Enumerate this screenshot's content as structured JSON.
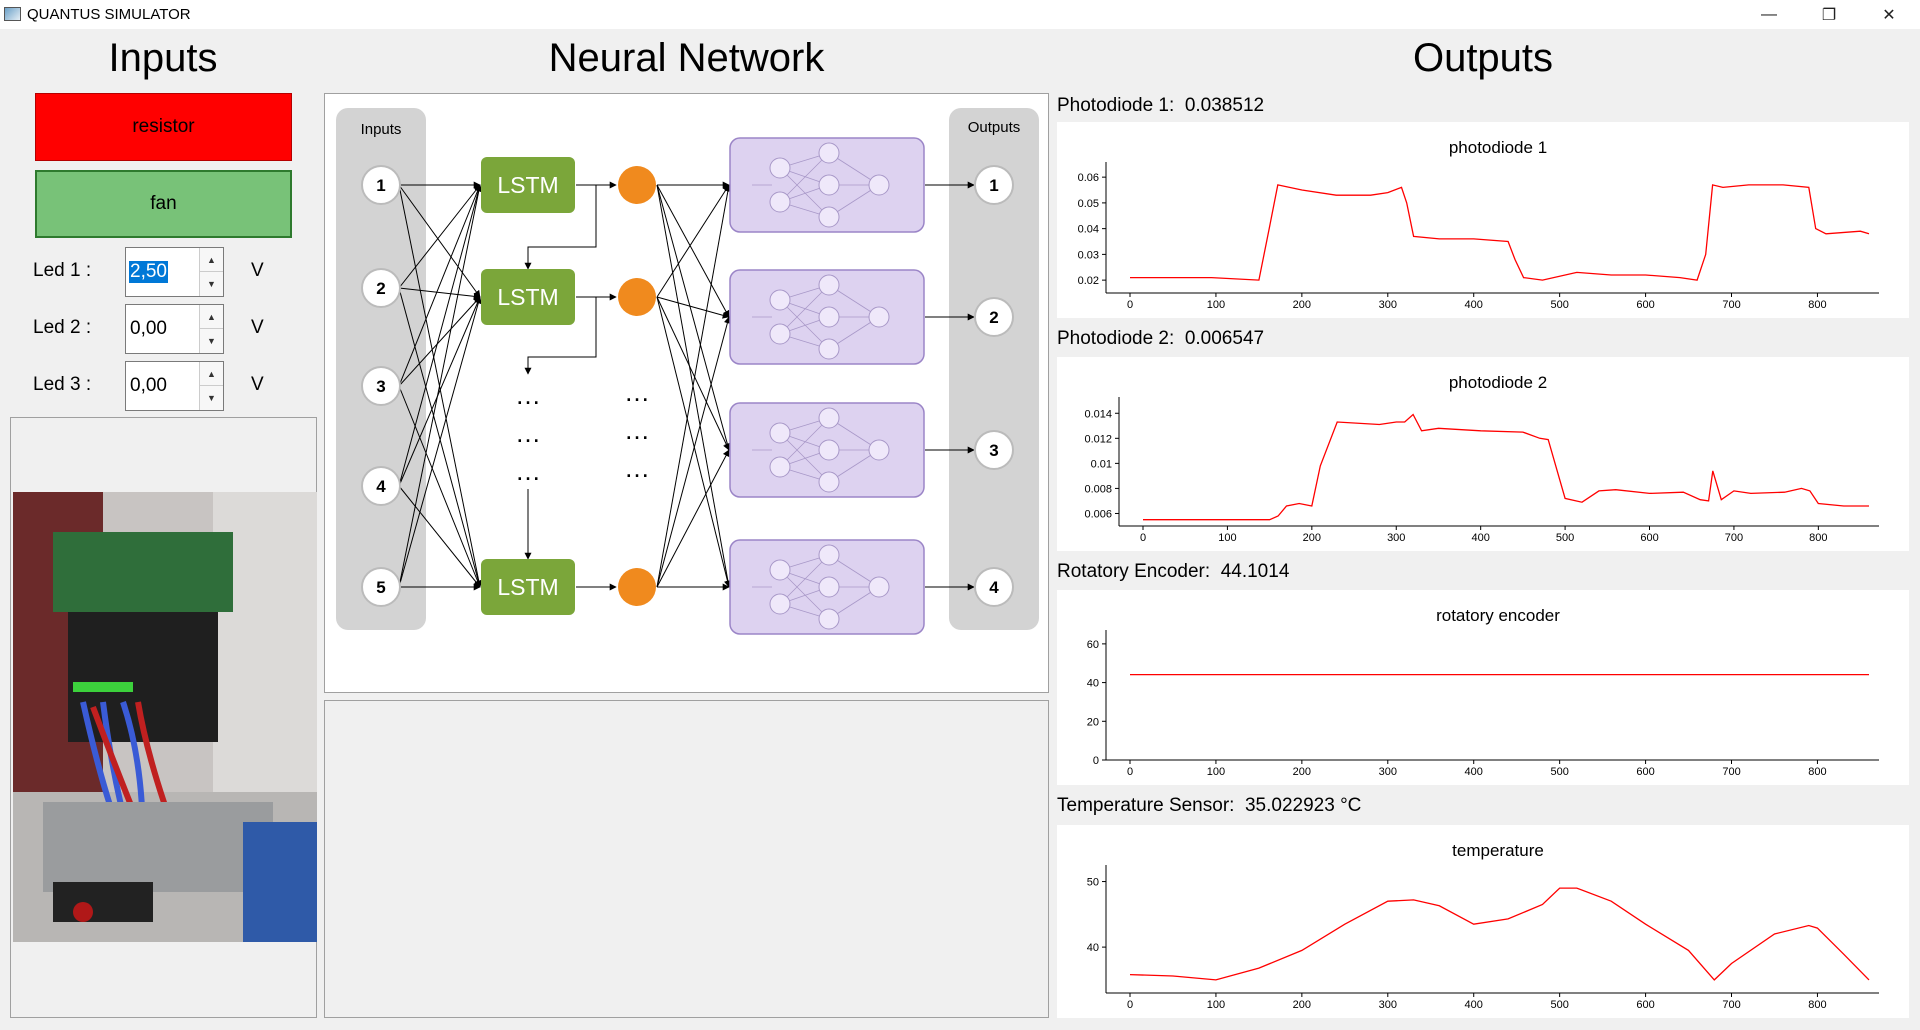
{
  "window": {
    "title": "QUANTUS SIMULATOR",
    "minimize_icon": "minimize-icon",
    "restore_icon": "restore-icon",
    "close_icon": "close-icon"
  },
  "inputs": {
    "title": "Inputs",
    "resistor_label": "resistor",
    "resistor_color": "#ff0000",
    "fan_label": "fan",
    "fan_color": "#78c278",
    "leds": [
      {
        "label": "Led 1 :",
        "value": "2,50",
        "unit": "V"
      },
      {
        "label": "Led 2 :",
        "value": "0,00",
        "unit": "V"
      },
      {
        "label": "Led 3 :",
        "value": "0,00",
        "unit": "V"
      }
    ]
  },
  "network": {
    "title": "Neural Network",
    "inputs_header": "Inputs",
    "outputs_header": "Outputs",
    "input_nodes": [
      "1",
      "2",
      "3",
      "4",
      "5"
    ],
    "lstm_label": "LSTM",
    "output_nodes": [
      "1",
      "2",
      "3",
      "4"
    ],
    "ellipsis": "…",
    "lstm_color": "#7ba63a",
    "neuron_color": "#f08a1e",
    "block_color": "#ddd2f0"
  },
  "outputs": {
    "title": "Outputs",
    "sensors": [
      {
        "label": "Photodiode 1:",
        "value": "0.038512"
      },
      {
        "label": "Photodiode 2:",
        "value": "0.006547"
      },
      {
        "label": "Rotatory Encoder:",
        "value": "44.1014"
      },
      {
        "label": "Temperature Sensor:",
        "value": "35.022923 °C"
      }
    ]
  },
  "chart_data": [
    {
      "type": "line",
      "title": "photodiode 1",
      "ylim": [
        0.015,
        0.062
      ],
      "xlim": [
        0,
        860
      ],
      "x_ticks": [
        "0",
        "100",
        "200",
        "300",
        "400",
        "500",
        "600",
        "700",
        "800"
      ],
      "y_ticks": [
        "0.02",
        "0.03",
        "0.04",
        "0.05",
        "0.06"
      ],
      "line_color": "#ff0000",
      "x": [
        0,
        95,
        150,
        162,
        172,
        200,
        240,
        280,
        300,
        316,
        322,
        330,
        360,
        400,
        440,
        448,
        458,
        480,
        520,
        560,
        600,
        640,
        660,
        670,
        678,
        690,
        720,
        760,
        790,
        798,
        810,
        850,
        860
      ],
      "y": [
        0.021,
        0.021,
        0.02,
        0.04,
        0.057,
        0.055,
        0.053,
        0.053,
        0.054,
        0.056,
        0.05,
        0.037,
        0.036,
        0.036,
        0.035,
        0.028,
        0.021,
        0.02,
        0.023,
        0.022,
        0.022,
        0.021,
        0.02,
        0.03,
        0.057,
        0.056,
        0.057,
        0.057,
        0.056,
        0.04,
        0.038,
        0.039,
        0.038
      ]
    },
    {
      "type": "line",
      "title": "photodiode 2",
      "ylim": [
        0.005,
        0.0145
      ],
      "xlim": [
        0,
        860
      ],
      "x_ticks": [
        "0",
        "100",
        "200",
        "300",
        "400",
        "500",
        "600",
        "700",
        "800"
      ],
      "y_ticks": [
        "0.006",
        "0.008",
        "0.01",
        "0.012",
        "0.014"
      ],
      "line_color": "#ff0000",
      "x": [
        0,
        100,
        150,
        160,
        170,
        185,
        200,
        210,
        230,
        280,
        300,
        310,
        320,
        330,
        350,
        400,
        450,
        470,
        480,
        500,
        520,
        540,
        560,
        600,
        640,
        660,
        670,
        675,
        685,
        700,
        720,
        760,
        780,
        790,
        800,
        830,
        860
      ],
      "y": [
        0.0055,
        0.0055,
        0.0055,
        0.0058,
        0.0066,
        0.0068,
        0.0066,
        0.0098,
        0.0133,
        0.0131,
        0.0133,
        0.0133,
        0.0139,
        0.0126,
        0.0128,
        0.0126,
        0.0125,
        0.012,
        0.0119,
        0.0072,
        0.0069,
        0.0078,
        0.0079,
        0.0076,
        0.0077,
        0.0071,
        0.007,
        0.0094,
        0.0071,
        0.0078,
        0.0076,
        0.0077,
        0.008,
        0.0078,
        0.0068,
        0.0066,
        0.0066
      ]
    },
    {
      "type": "line",
      "title": "rotatory encoder",
      "ylim": [
        0,
        62
      ],
      "xlim": [
        0,
        860
      ],
      "x_ticks": [
        "0",
        "100",
        "200",
        "300",
        "400",
        "500",
        "600",
        "700",
        "800"
      ],
      "y_ticks": [
        "0",
        "20",
        "40",
        "60"
      ],
      "line_color": "#ff0000",
      "x": [
        0,
        860
      ],
      "y": [
        44.1,
        44.1
      ]
    },
    {
      "type": "line",
      "title": "temperature",
      "ylim": [
        33,
        51
      ],
      "xlim": [
        0,
        860
      ],
      "x_ticks": [
        "0",
        "100",
        "200",
        "300",
        "400",
        "500",
        "600",
        "700",
        "800"
      ],
      "y_ticks": [
        "40",
        "50"
      ],
      "line_color": "#ff0000",
      "x": [
        0,
        50,
        100,
        150,
        200,
        250,
        300,
        330,
        360,
        400,
        440,
        480,
        500,
        520,
        560,
        600,
        650,
        680,
        700,
        750,
        790,
        800,
        830,
        860
      ],
      "y": [
        35.8,
        35.6,
        35.0,
        36.8,
        39.5,
        43.5,
        47.0,
        47.2,
        46.3,
        43.5,
        44.3,
        46.5,
        49.0,
        49.0,
        47.0,
        43.5,
        39.5,
        35.0,
        37.5,
        42.0,
        43.3,
        42.9,
        39.0,
        35.0
      ]
    }
  ]
}
